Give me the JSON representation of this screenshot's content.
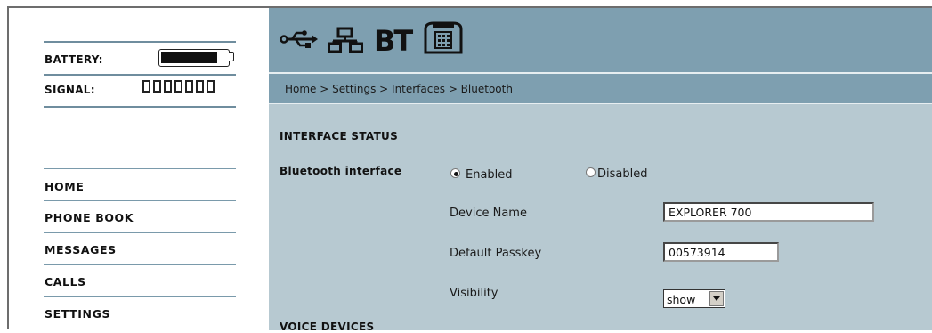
{
  "sidebar": {
    "battery_label": "BATTERY:",
    "battery_level": 0.88,
    "signal_label": "SIGNAL:",
    "signal_bars_total": 7,
    "signal_bars_active": 0,
    "nav": [
      {
        "label": "HOME"
      },
      {
        "label": "PHONE BOOK"
      },
      {
        "label": "MESSAGES"
      },
      {
        "label": "CALLS"
      },
      {
        "label": "SETTINGS"
      }
    ]
  },
  "header": {
    "icons": [
      "usb-icon",
      "network-icon",
      "bluetooth-icon",
      "telephone-icon"
    ],
    "bt_text": "BT"
  },
  "breadcrumb": "Home > Settings > Interfaces > Bluetooth",
  "interface_status": {
    "title": "INTERFACE STATUS",
    "bluetooth_label": "Bluetooth interface",
    "enabled_label": "Enabled",
    "disabled_label": "Disabled",
    "selected": "enabled",
    "device_name_label": "Device Name",
    "device_name_value": "EXPLORER 700",
    "passkey_label": "Default Passkey",
    "passkey_value": "00573914",
    "visibility_label": "Visibility",
    "visibility_value": "show"
  },
  "voice_devices": {
    "title": "VOICE DEVICES"
  },
  "colors": {
    "header_bg": "#7e9fb0",
    "content_bg": "#b7c9d1"
  }
}
